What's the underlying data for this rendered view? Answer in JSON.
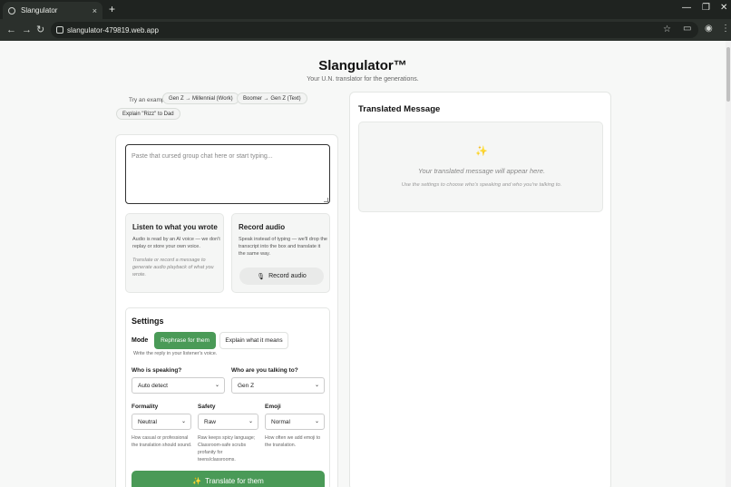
{
  "browser": {
    "tab_title": "Slangulator",
    "url": "slangulator-479819.web.app",
    "new_tab": "+",
    "tab_close": "×"
  },
  "header": {
    "title": "Slangulator™",
    "subtitle": "Your U.N. translator for the generations."
  },
  "examples": {
    "label": "Try an example:",
    "chips": [
      "Gen Z → Millennial (Work)",
      "Boomer → Gen Z (Text)",
      "Explain \"Rizz\" to Dad"
    ]
  },
  "input": {
    "placeholder": "Paste that cursed group chat here or start typing..."
  },
  "listen": {
    "title": "Listen to what you wrote",
    "body": "Audio is read by an AI voice — we don't replay or store your own voice.",
    "note": "Translate or record a message to generate audio playback of what you wrote."
  },
  "record": {
    "title": "Record audio",
    "body": "Speak instead of typing — we'll drop the transcript into the box and translate it the same way.",
    "button_label": "Record audio",
    "button_icon": "microphone-icon"
  },
  "settings": {
    "title": "Settings",
    "mode_label": "Mode",
    "mode_options": [
      "Rephrase for them",
      "Explain what it means"
    ],
    "mode_selected": "Rephrase for them",
    "mode_help": "Write the reply in your listener's voice.",
    "speaker_label": "Who is speaking?",
    "speaker_value": "Auto detect",
    "listener_label": "Who are you talking to?",
    "listener_value": "Gen Z",
    "formality_label": "Formality",
    "formality_value": "Neutral",
    "formality_help": "How casual or professional the translation should sound.",
    "safety_label": "Safety",
    "safety_value": "Raw",
    "safety_help": "Raw keeps spicy language; Classroom-safe scrubs profanity for teens/classrooms.",
    "emoji_label": "Emoji",
    "emoji_value": "Normal",
    "emoji_help": "How often we add emoji to the translation.",
    "translate_label": "Translate for them"
  },
  "output": {
    "title": "Translated Message",
    "empty_main": "Your translated message will appear here.",
    "empty_sub": "Use the settings to choose who's speaking and who you're talking to."
  },
  "colors": {
    "accent": "#4a9a57",
    "chrome_dark": "#1f2320"
  }
}
